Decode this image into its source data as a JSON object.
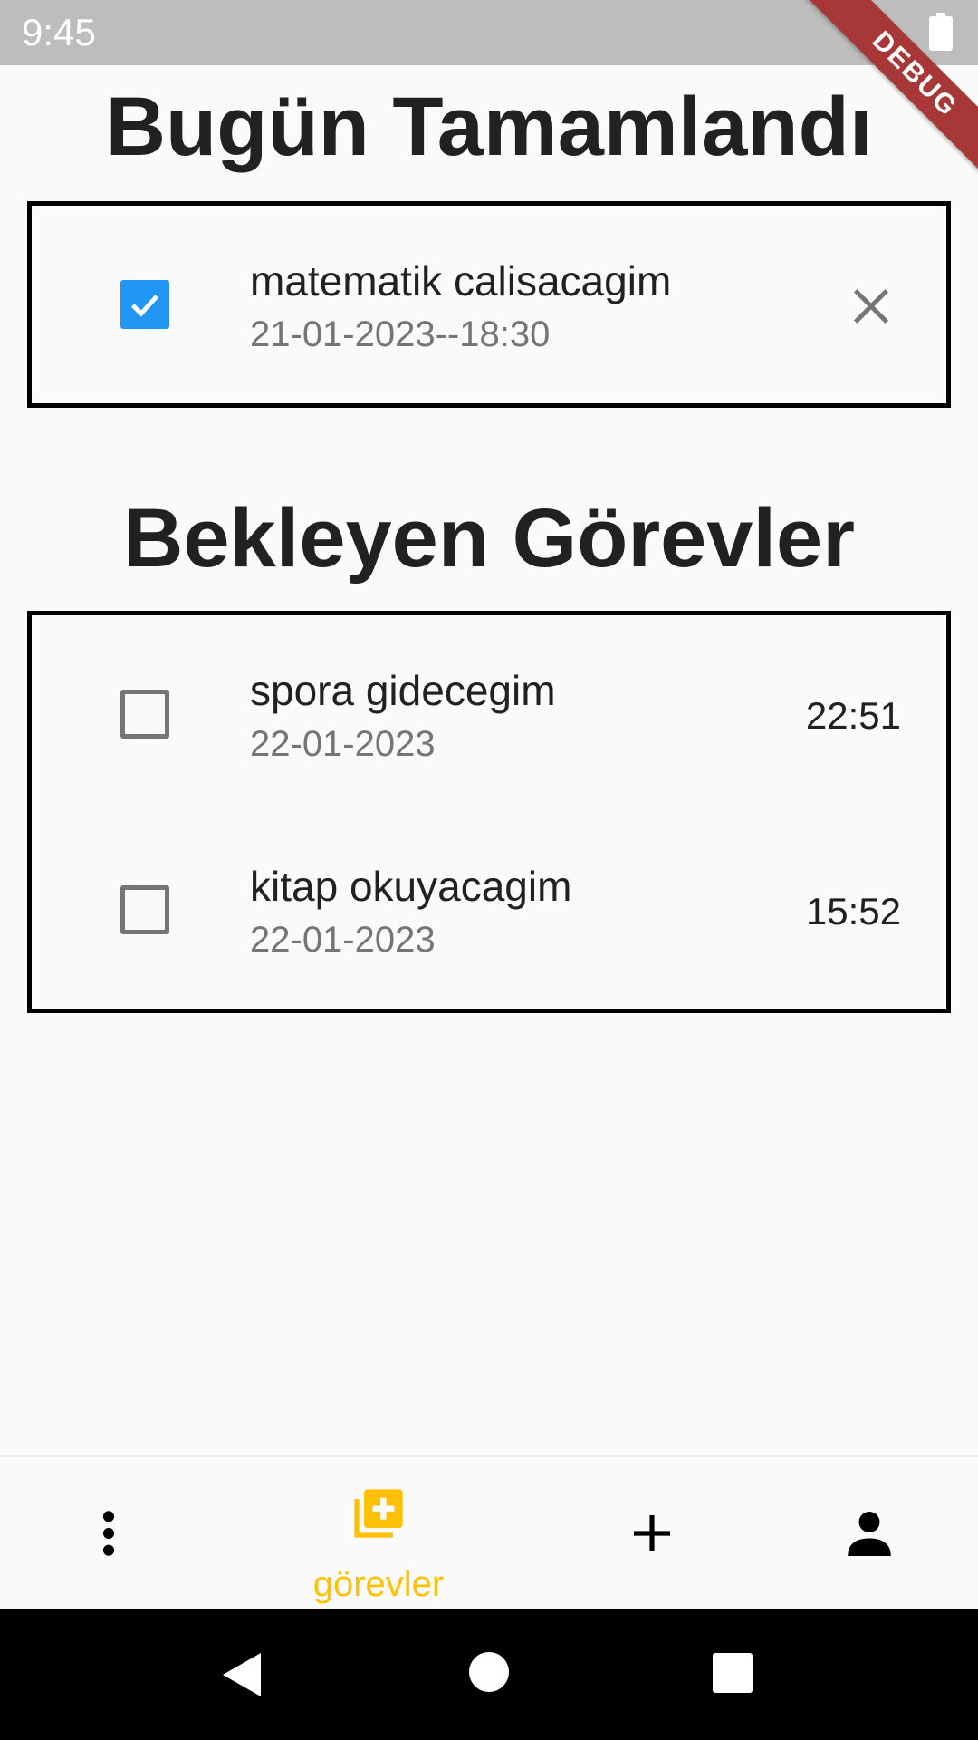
{
  "status_bar": {
    "time": "9:45",
    "debug_label": "DEBUG"
  },
  "sections": {
    "completed": {
      "title": "Bugün Tamamlandı",
      "tasks": [
        {
          "title": "matematik calisacagim",
          "date": "21-01-2023--18:30",
          "checked": true
        }
      ]
    },
    "pending": {
      "title": "Bekleyen Görevler",
      "tasks": [
        {
          "title": "spora gidecegim",
          "date": "22-01-2023",
          "time": "22:51",
          "checked": false
        },
        {
          "title": "kitap okuyacagim",
          "date": "22-01-2023",
          "time": "15:52",
          "checked": false
        }
      ]
    }
  },
  "bottom_nav": {
    "items": [
      {
        "icon": "more-vert-icon"
      },
      {
        "icon": "library-add-icon",
        "label": "görevler",
        "active": true
      },
      {
        "icon": "add-icon"
      },
      {
        "icon": "person-icon"
      }
    ],
    "active_color": "#ffc107"
  },
  "colors": {
    "checkbox_checked": "#2196f3",
    "debug_banner": "#a83737"
  }
}
